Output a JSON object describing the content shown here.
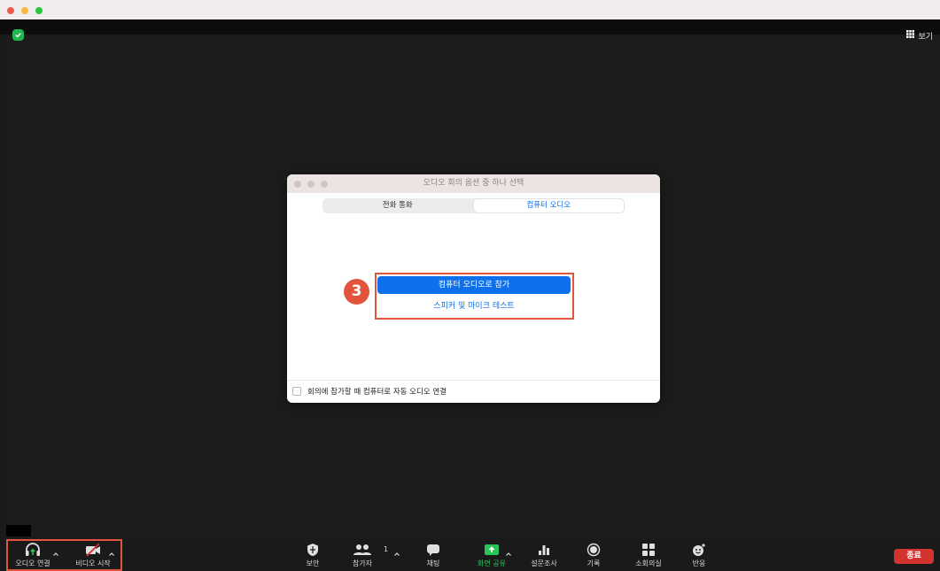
{
  "meeting": {
    "view_label": "보기"
  },
  "modal": {
    "title": "오디오 회의 옵션 중 하나 선택",
    "tabs": [
      {
        "label": "전화 통화",
        "active": false
      },
      {
        "label": "컴퓨터 오디오",
        "active": true
      }
    ],
    "join_button": "컴퓨터 오디오로 참가",
    "test_link": "스피커 및 마이크 테스트",
    "step_number": "3",
    "auto_join_checkbox": {
      "label": "회의에 참가할 때 컴퓨터로 자동 오디오 연결",
      "checked": false
    }
  },
  "toolbar": {
    "audio": "오디오 연결",
    "video": "비디오 시작",
    "security": "보안",
    "participants": "참가자",
    "participant_count": "1",
    "chat": "채팅",
    "share": "화면 공유",
    "poll": "설문조사",
    "record": "기록",
    "breakout": "소회의실",
    "reactions": "반응",
    "end": "종료"
  },
  "colors": {
    "accent": "#0e71eb",
    "highlight": "#e2543d",
    "share_green": "#28c456",
    "end_red": "#d3322f"
  },
  "icons": [
    "shield-icon",
    "grid-icon",
    "headphones-icon",
    "video-off-icon",
    "participants-icon",
    "chat-icon",
    "share-screen-icon",
    "poll-icon",
    "record-icon",
    "breakout-icon",
    "reaction-icon",
    "chevron-up-icon"
  ]
}
